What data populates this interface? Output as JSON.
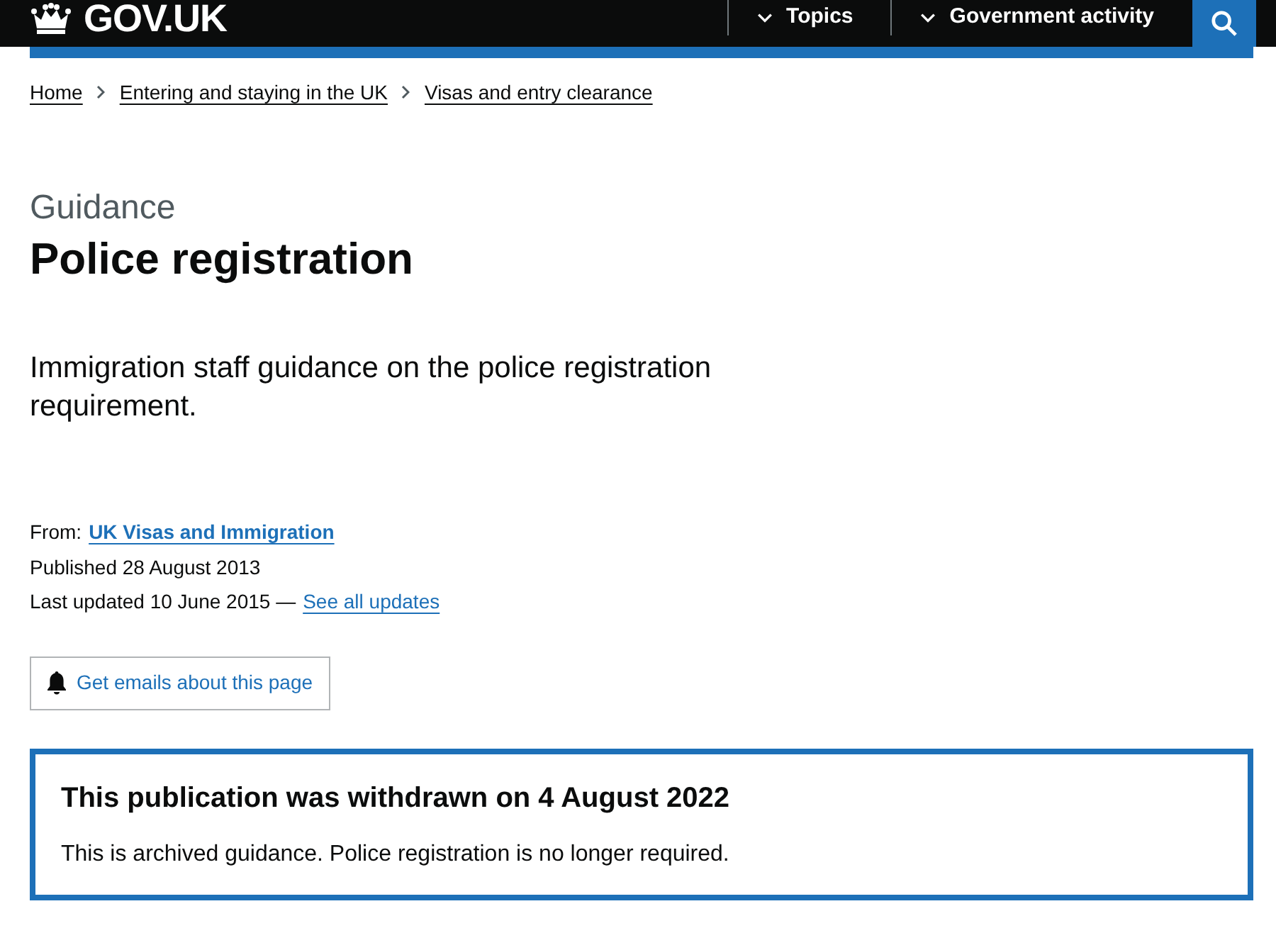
{
  "header": {
    "logo": "GOV.UK",
    "nav": [
      {
        "label": "Topics"
      },
      {
        "label": "Government activity"
      }
    ]
  },
  "breadcrumbs": [
    "Home",
    "Entering and staying in the UK",
    "Visas and entry clearance"
  ],
  "title": {
    "caption": "Guidance",
    "heading": "Police registration"
  },
  "lede": "Immigration staff guidance on the police registration requirement.",
  "metadata": {
    "from_label": "From:",
    "from_link": "UK Visas and Immigration",
    "published": "Published 28 August 2013",
    "updated": "Last updated 10 June 2015 —",
    "updates_link": "See all updates"
  },
  "subscribe_button": "Get emails about this page",
  "notice": {
    "heading": "This publication was withdrawn on 4 August 2022",
    "body": "This is archived guidance. Police registration is no longer required."
  }
}
